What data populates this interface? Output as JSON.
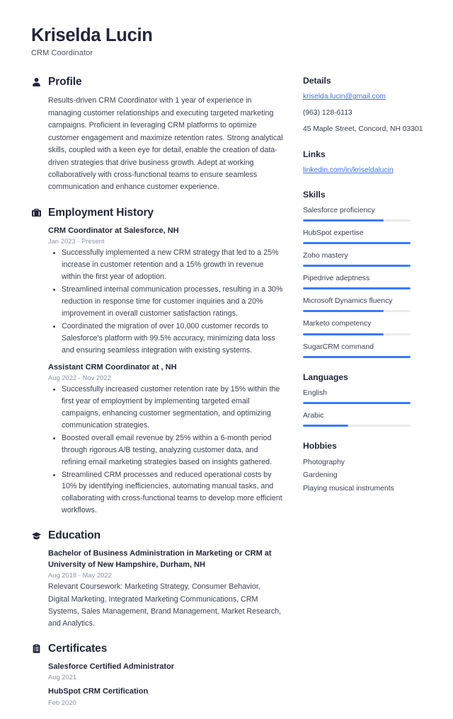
{
  "header": {
    "name": "Kriselda Lucin",
    "title": "CRM Coordinator"
  },
  "colors": {
    "accent": "#3a7afe",
    "link": "#3f73e3",
    "heading": "#23273b",
    "body_text": "#3b4153",
    "muted": "#8d93a3",
    "track": "#eaeaec"
  },
  "main": {
    "profile": {
      "icon": "user-icon",
      "heading": "Profile",
      "text": "Results-driven CRM Coordinator with 1 year of experience in managing customer relationships and executing targeted marketing campaigns. Proficient in leveraging CRM platforms to optimize customer engagement and maximize retention rates. Strong analytical skills, coupled with a keen eye for detail, enable the creation of data-driven strategies that drive business growth. Adept at working collaboratively with cross-functional teams to ensure seamless communication and enhance customer experience."
    },
    "employment": {
      "icon": "briefcase-icon",
      "heading": "Employment History",
      "entries": [
        {
          "title": "CRM Coordinator at Salesforce, NH",
          "date": "Jan 2023 - Present",
          "bullets": [
            "Successfully implemented a new CRM strategy that led to a 25% increase in customer retention and a 15% growth in revenue within the first year of adoption.",
            "Streamlined internal communication processes, resulting in a 30% reduction in response time for customer inquiries and a 20% improvement in overall customer satisfaction ratings.",
            "Coordinated the migration of over 10,000 customer records to Salesforce's platform with 99.5% accuracy, minimizing data loss and ensuring seamless integration with existing systems."
          ]
        },
        {
          "title": "Assistant CRM Coordinator at , NH",
          "date": "Aug 2022 - Nov 2022",
          "bullets": [
            "Successfully increased customer retention rate by 15% within the first year of employment by implementing targeted email campaigns, enhancing customer segmentation, and optimizing communication strategies.",
            "Boosted overall email revenue by 25% within a 6-month period through rigorous A/B testing, analyzing customer data, and refining email marketing strategies based on insights gathered.",
            "Streamlined CRM processes and reduced operational costs by 10% by identifying inefficiencies, automating manual tasks, and collaborating with cross-functional teams to develop more efficient workflows."
          ]
        }
      ]
    },
    "education": {
      "icon": "graduation-cap-icon",
      "heading": "Education",
      "entries": [
        {
          "title": "Bachelor of Business Administration in Marketing or CRM at University of New Hampshire, Durham, NH",
          "date": "Aug 2018 - May 2022",
          "description": "Relevant Coursework: Marketing Strategy, Consumer Behavior, Digital Marketing, Integrated Marketing Communications, CRM Systems, Sales Management, Brand Management, Market Research, and Analytics."
        }
      ]
    },
    "certificates": {
      "icon": "clipboard-icon",
      "heading": "Certificates",
      "entries": [
        {
          "title": "Salesforce Certified Administrator",
          "date": "Aug 2021"
        },
        {
          "title": "HubSpot CRM Certification",
          "date": "Feb 2020"
        }
      ]
    }
  },
  "sidebar": {
    "details": {
      "heading": "Details",
      "email": "kriselda.lucin@gmail.com",
      "phone": "(963) 128-6113",
      "address": "45 Maple Street, Concord, NH 03301"
    },
    "links": {
      "heading": "Links",
      "items": [
        {
          "label": "linkedin.com/in/kriseldalucin"
        }
      ]
    },
    "skills": {
      "heading": "Skills",
      "items": [
        {
          "label": "Salesforce proficiency",
          "level": 75
        },
        {
          "label": "HubSpot expertise",
          "level": 100
        },
        {
          "label": "Zoho mastery",
          "level": 100
        },
        {
          "label": "Pipedrive adeptness",
          "level": 100
        },
        {
          "label": "Microsoft Dynamics fluency",
          "level": 75
        },
        {
          "label": "Marketo competency",
          "level": 75
        },
        {
          "label": "SugarCRM command",
          "level": 100
        }
      ]
    },
    "languages": {
      "heading": "Languages",
      "items": [
        {
          "label": "English",
          "level": 100
        },
        {
          "label": "Arabic",
          "level": 42
        }
      ]
    },
    "hobbies": {
      "heading": "Hobbies",
      "items": [
        {
          "label": "Photography"
        },
        {
          "label": "Gardening"
        },
        {
          "label": "Playing musical instruments"
        }
      ]
    }
  }
}
